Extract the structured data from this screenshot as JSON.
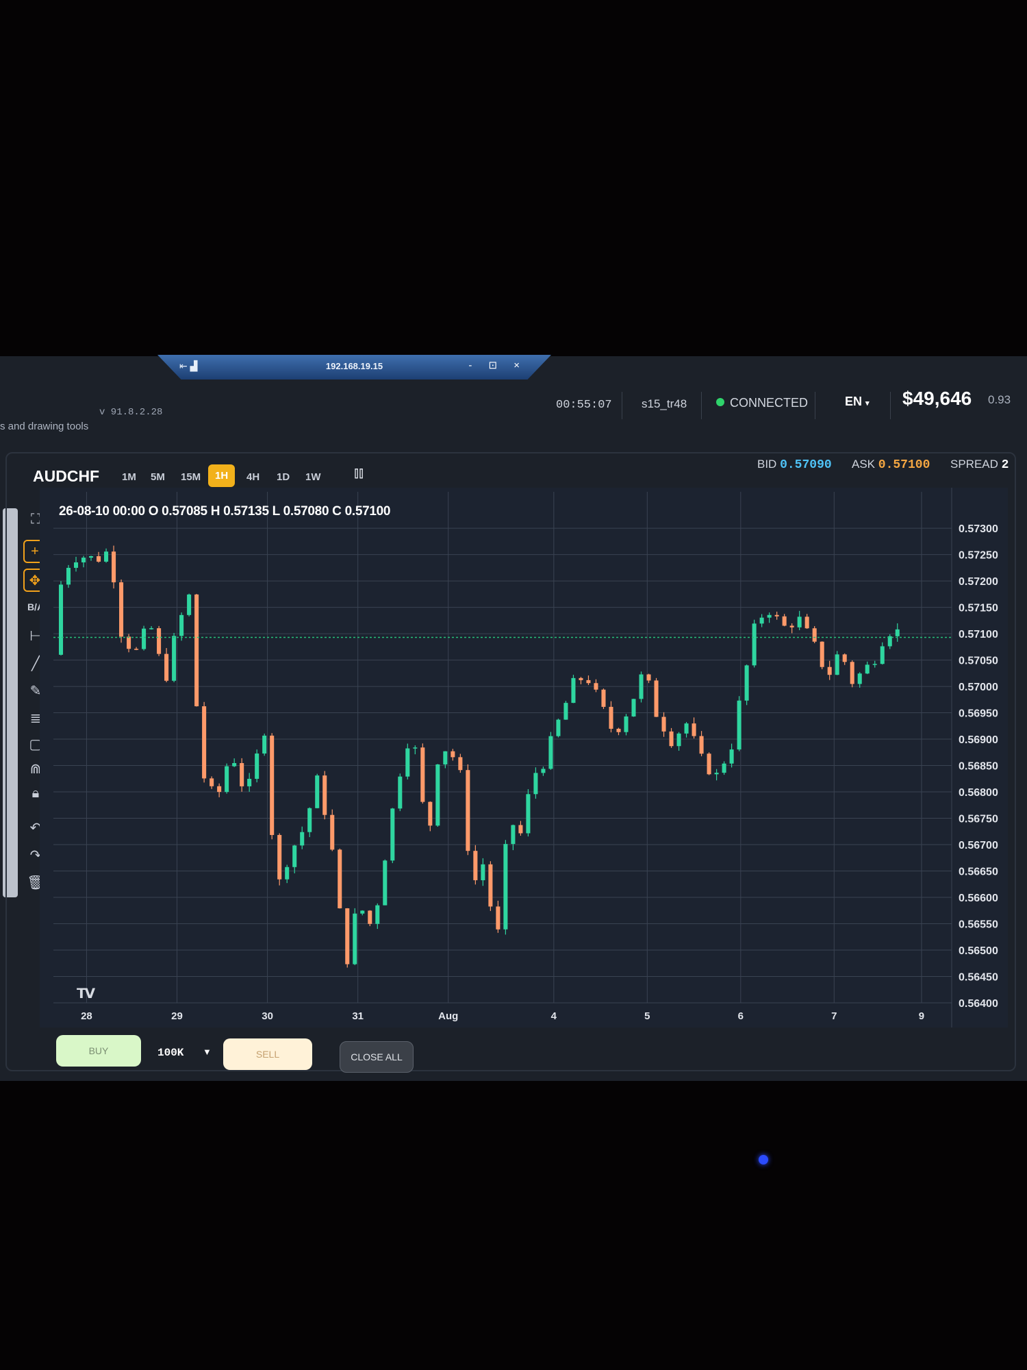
{
  "window": {
    "rdp_address": "192.168.19.15",
    "rdp_controls": "- ⊡ ×"
  },
  "header": {
    "tools_caption": "s and drawing tools",
    "version": "v 91.8.2.28",
    "clock": "00:55:07",
    "user": "s15_tr48",
    "status": "CONNECTED",
    "language": "EN",
    "balance": "$49,646",
    "ratio": "0.93",
    "status_color": "#2fd36b"
  },
  "instrument": {
    "symbol": "AUDCHF",
    "timeframes": [
      "1M",
      "5M",
      "15M",
      "1H",
      "4H",
      "1D",
      "1W"
    ],
    "active_timeframe": "1H",
    "bid_label": "BID",
    "bid": "0.57090",
    "ask_label": "ASK",
    "ask": "0.57100",
    "spread_label": "SPREAD",
    "spread": "2"
  },
  "toolbar": {
    "icons": [
      "fullscreen-icon",
      "crosshair-icon",
      "crosshair-move-icon",
      "bid-ask-icon",
      "horizontal-line-icon",
      "trend-line-icon",
      "pencil-icon",
      "fib-levels-icon",
      "rectangle-icon",
      "magnet-icon",
      "lock-icon",
      "undo-icon",
      "redo-icon",
      "trash-icon"
    ],
    "bid_ask_label": "B/A"
  },
  "chart_data": {
    "type": "candlestick",
    "ohlc_legend": "26-08-10 00:00 O 0.57085 H 0.57135 L 0.57080 C 0.57100",
    "y_ticks": [
      "0.57300",
      "0.57250",
      "0.57200",
      "0.57150",
      "0.57100",
      "0.57050",
      "0.57000",
      "0.56950",
      "0.56900",
      "0.56850",
      "0.56800",
      "0.56750",
      "0.56700",
      "0.56650",
      "0.56600",
      "0.56550",
      "0.56500",
      "0.56450",
      "0.56400"
    ],
    "ylim": [
      0.564,
      0.5733
    ],
    "x_ticks": [
      "28",
      "29",
      "30",
      "31",
      "Aug",
      "4",
      "5",
      "6",
      "7",
      "9"
    ],
    "x_tick_day_index": [
      0.55,
      2.05,
      3.55,
      5.05,
      6.55,
      8.3,
      9.85,
      11.4,
      12.95,
      14.4
    ],
    "days": 14.9,
    "current_price": 0.57093,
    "up_color": "#2fd6a0",
    "down_color": "#ff9a6a",
    "price_line_color": "#27c07a",
    "grid": true,
    "close_path": [
      [
        0.0,
        0.5706
      ],
      [
        0.15,
        0.5722
      ],
      [
        0.4,
        0.5725
      ],
      [
        0.7,
        0.5724
      ],
      [
        0.95,
        0.5726
      ],
      [
        1.1,
        0.5711
      ],
      [
        1.35,
        0.5706
      ],
      [
        1.6,
        0.5712
      ],
      [
        1.85,
        0.5701
      ],
      [
        2.05,
        0.5711
      ],
      [
        2.25,
        0.5717
      ],
      [
        2.45,
        0.5684
      ],
      [
        2.7,
        0.5678
      ],
      [
        2.95,
        0.5688
      ],
      [
        3.2,
        0.5679
      ],
      [
        3.5,
        0.5692
      ],
      [
        3.7,
        0.5661
      ],
      [
        3.9,
        0.5668
      ],
      [
        4.15,
        0.5673
      ],
      [
        4.4,
        0.5683
      ],
      [
        4.65,
        0.5667
      ],
      [
        4.85,
        0.5647
      ],
      [
        5.05,
        0.5659
      ],
      [
        5.3,
        0.5654
      ],
      [
        5.6,
        0.5675
      ],
      [
        5.85,
        0.569
      ],
      [
        6.05,
        0.5687
      ],
      [
        6.2,
        0.5668
      ],
      [
        6.35,
        0.5686
      ],
      [
        6.55,
        0.5689
      ],
      [
        6.75,
        0.5683
      ],
      [
        6.95,
        0.5662
      ],
      [
        7.15,
        0.5667
      ],
      [
        7.35,
        0.565
      ],
      [
        7.55,
        0.5675
      ],
      [
        7.75,
        0.5672
      ],
      [
        7.95,
        0.5683
      ],
      [
        8.15,
        0.5686
      ],
      [
        8.4,
        0.5694
      ],
      [
        8.65,
        0.5701
      ],
      [
        8.85,
        0.5702
      ],
      [
        9.05,
        0.5697
      ],
      [
        9.3,
        0.5691
      ],
      [
        9.55,
        0.5696
      ],
      [
        9.8,
        0.5703
      ],
      [
        10.0,
        0.5695
      ],
      [
        10.25,
        0.569
      ],
      [
        10.5,
        0.5693
      ],
      [
        10.75,
        0.5686
      ],
      [
        11.0,
        0.5683
      ],
      [
        11.25,
        0.5689
      ],
      [
        11.45,
        0.5701
      ],
      [
        11.65,
        0.5712
      ],
      [
        11.85,
        0.5715
      ],
      [
        12.1,
        0.5711
      ],
      [
        12.35,
        0.5713
      ],
      [
        12.6,
        0.5708
      ],
      [
        12.85,
        0.5702
      ],
      [
        13.05,
        0.5707
      ],
      [
        13.25,
        0.5701
      ],
      [
        13.45,
        0.5703
      ],
      [
        13.6,
        0.5705
      ],
      [
        13.75,
        0.5709
      ],
      [
        13.9,
        0.5711
      ],
      [
        14.05,
        0.571
      ]
    ]
  },
  "trade_panel": {
    "buy_label": "BUY",
    "lot_size": "100K",
    "sell_label": "SELL",
    "close_all_label": "CLOSE ALL"
  }
}
